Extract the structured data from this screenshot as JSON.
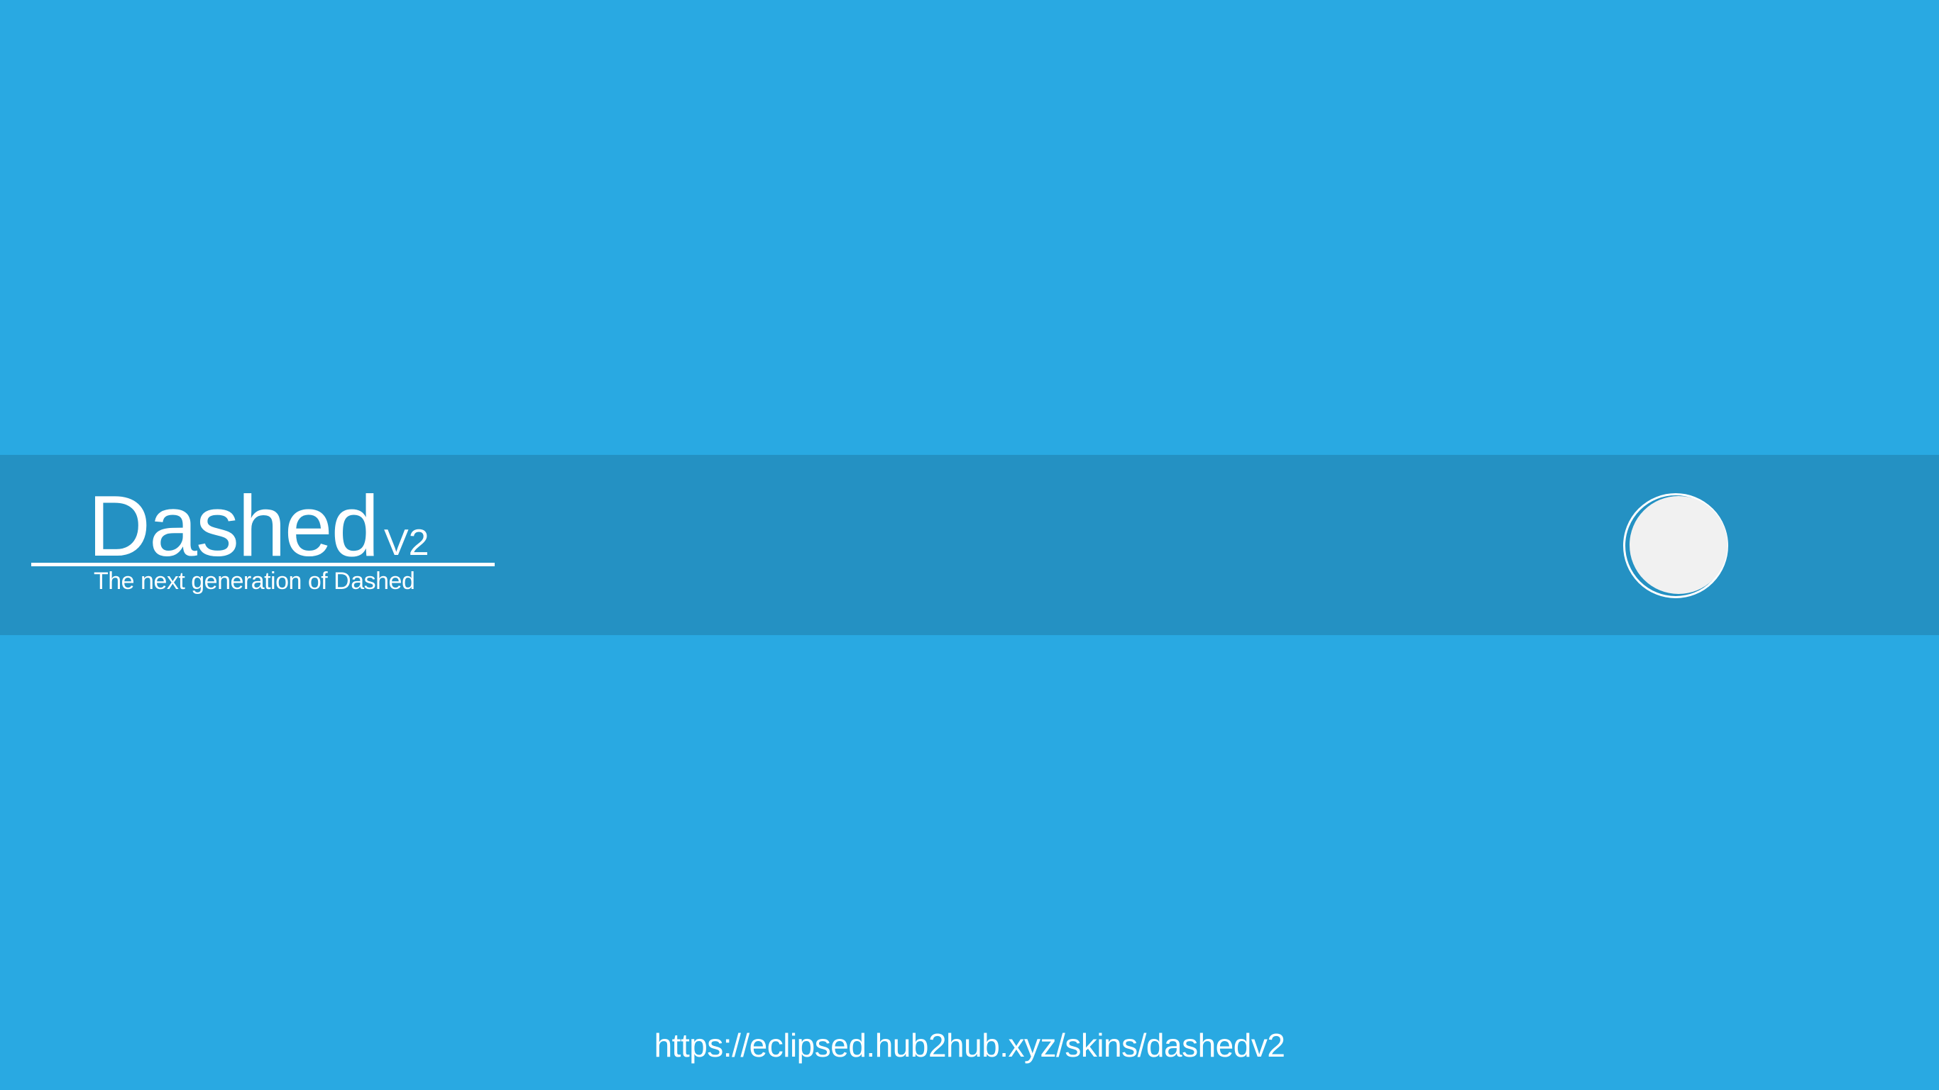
{
  "app": {
    "title": "Dashed",
    "version": "V2",
    "subtitle": "The next generation of Dashed"
  },
  "footer": {
    "url": "https://eclipsed.hub2hub.xyz/skins/dashedv2"
  },
  "colors": {
    "background": "#29a9e2",
    "band": "#2491c3",
    "text": "#ffffff",
    "circle": "#f1f1f1"
  }
}
